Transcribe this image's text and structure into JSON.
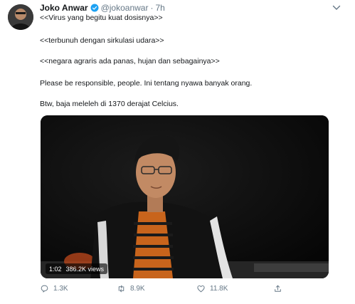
{
  "tweet": {
    "display_name": "Joko Anwar",
    "handle": "@jokoanwar",
    "separator": "·",
    "time": "7h",
    "lines": [
      "<<Virus yang begitu kuat dosisnya>>",
      "<<terbunuh dengan sirkulasi udara>>",
      "<<negara agraris ada panas, hujan dan sebagainya>>",
      "Please be responsible, people. Ini tentang nyawa banyak orang.",
      "Btw, baja meleleh di 1370 derajat Celcius."
    ]
  },
  "video": {
    "duration": "1:02",
    "views": "386.2K views"
  },
  "actions": {
    "reply_count": "1.3K",
    "retweet_count": "8.9K",
    "like_count": "11.8K"
  },
  "icons": {
    "verified": "verified-badge-icon",
    "menu": "chevron-down-icon",
    "reply": "reply-icon",
    "retweet": "retweet-icon",
    "like": "heart-icon",
    "share": "share-icon"
  },
  "colors": {
    "accent": "#1da1f2",
    "muted": "#657786",
    "text": "#14171a"
  }
}
